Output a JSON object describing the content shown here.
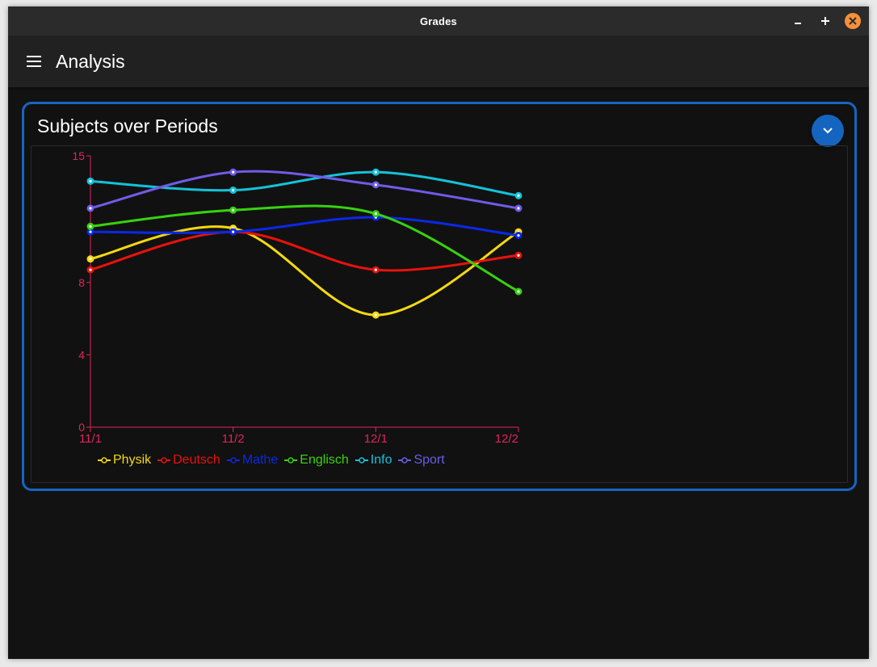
{
  "window": {
    "title": "Grades"
  },
  "appbar": {
    "title": "Analysis",
    "menu_icon": "menu-icon"
  },
  "card": {
    "title": "Subjects over Periods",
    "expand_icon": "chevron-down-icon",
    "border_color": "#1565c0"
  },
  "chart_data": {
    "type": "line",
    "title": "",
    "xlabel": "",
    "ylabel": "",
    "categories": [
      "11/1",
      "11/2",
      "12/1",
      "12/2"
    ],
    "ylim": [
      0,
      15
    ],
    "yticks": [
      0,
      4,
      8,
      15
    ],
    "axis_color": "#e0245e",
    "grid": false,
    "legend_position": "bottom",
    "series": [
      {
        "name": "Physik",
        "color": "#f5d90f",
        "values": [
          9.3,
          11,
          6.2,
          10.8
        ]
      },
      {
        "name": "Deutsch",
        "color": "#e8120c",
        "values": [
          8.7,
          10.8,
          8.7,
          9.5
        ]
      },
      {
        "name": "Mathe",
        "color": "#0a28e8",
        "values": [
          10.8,
          10.8,
          11.6,
          10.6
        ]
      },
      {
        "name": "Englisch",
        "color": "#37d20f",
        "values": [
          11.1,
          12,
          11.8,
          7.5
        ]
      },
      {
        "name": "Info",
        "color": "#14c2d8",
        "values": [
          13.6,
          13.1,
          14.1,
          12.8
        ]
      },
      {
        "name": "Sport",
        "color": "#6e5ce6",
        "values": [
          12.1,
          14.1,
          13.4,
          12.1
        ]
      }
    ]
  }
}
